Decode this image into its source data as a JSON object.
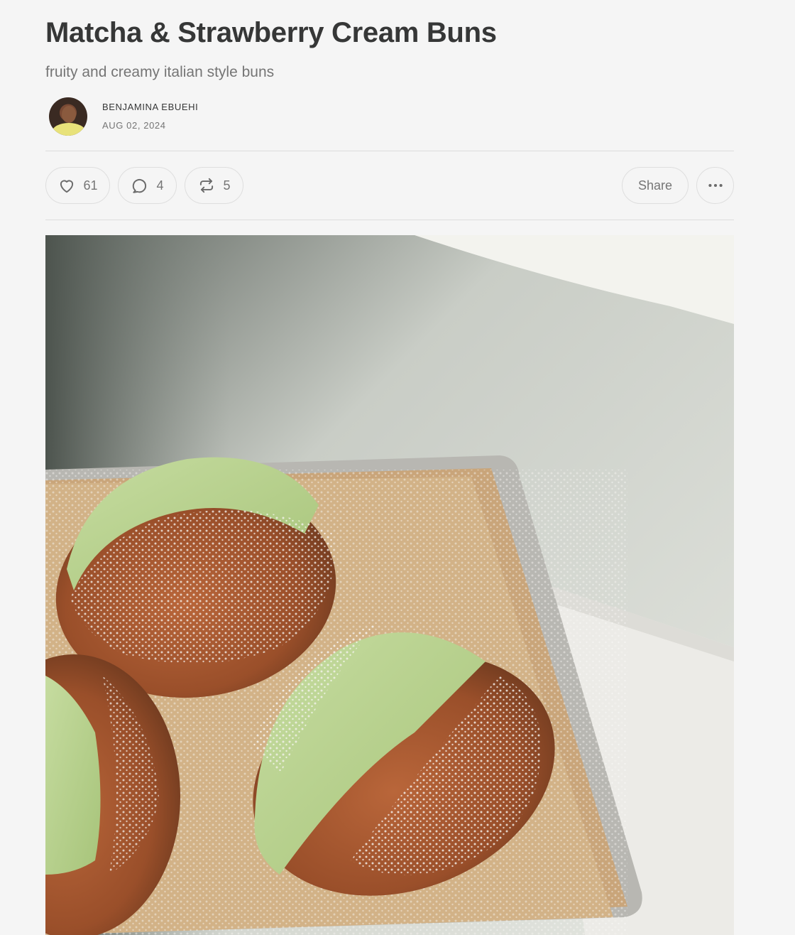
{
  "post": {
    "title": "Matcha & Strawberry Cream Buns",
    "subtitle": "fruity and creamy italian style buns",
    "author": "BENJAMINA EBUEHI",
    "date": "AUG 02, 2024"
  },
  "actions": {
    "likes": "61",
    "comments": "4",
    "restacks": "5",
    "share_label": "Share"
  },
  "icons": {
    "like": "heart-icon",
    "comment": "comment-bubble-icon",
    "restack": "restack-icon",
    "more": "ellipsis-icon"
  },
  "colors": {
    "background": "#f5f5f5",
    "text": "#363737",
    "muted": "#757575",
    "border": "#dedede"
  }
}
